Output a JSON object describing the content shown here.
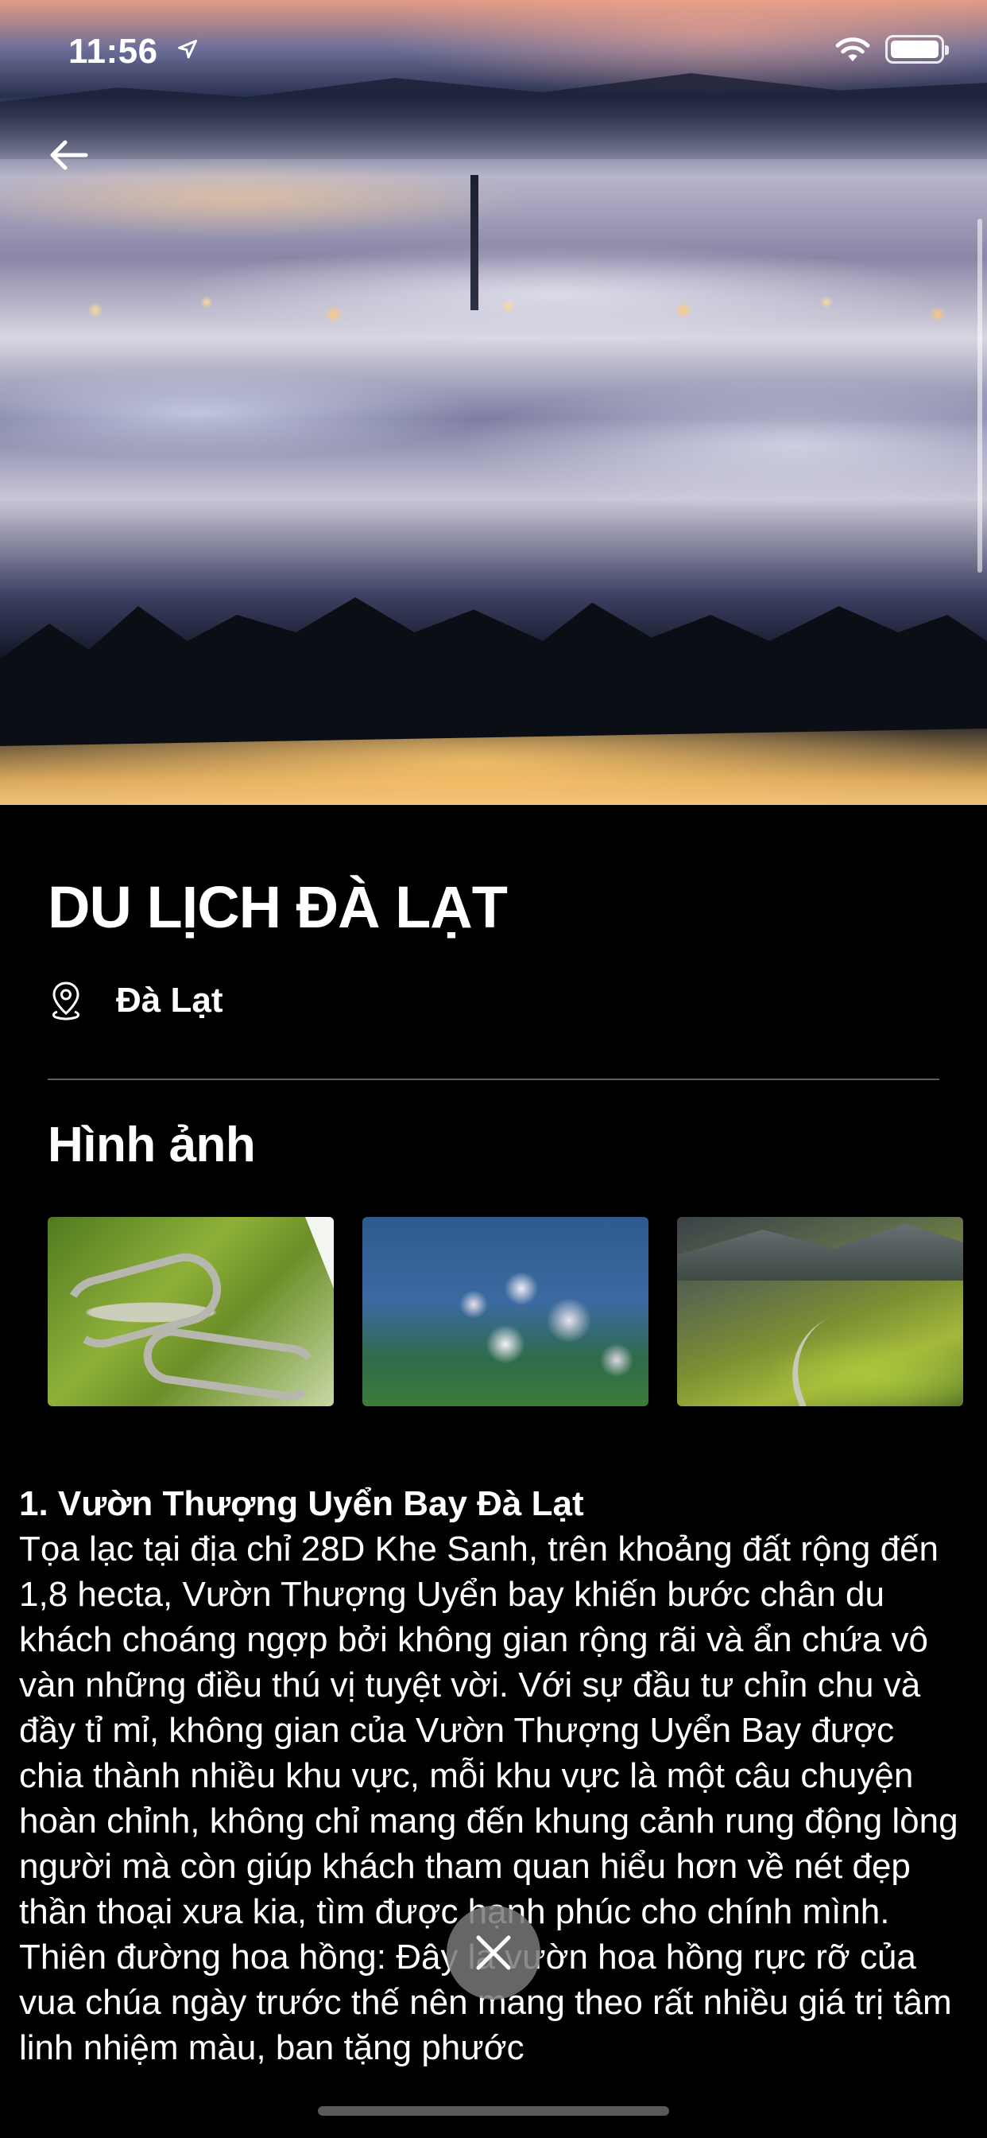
{
  "status_bar": {
    "time": "11:56"
  },
  "destination": {
    "title": "DU LỊCH ĐÀ LẠT",
    "location": "Đà Lạt"
  },
  "gallery": {
    "title": "Hình ảnh",
    "images": [
      "mountain-pass-road-photo",
      "blossom-tree-photo",
      "rice-terrace-valley-photo"
    ]
  },
  "article": {
    "heading": "1. Vườn Thượng Uyển Bay Đà Lạt",
    "paragraph_1": "Tọa lạc tại địa chỉ 28D Khe Sanh, trên khoảng đất rộng đến 1,8 hecta, Vườn Thượng Uyển bay khiến bước chân du khách choáng ngợp bởi không gian rộng rãi và ẩn chứa vô vàn những điều thú vị tuyệt vời. Với sự đầu tư chỉn chu và đầy tỉ mỉ, không gian của Vườn Thượng Uyển Bay được chia thành nhiều khu vực, mỗi khu vực là một câu chuyện hoàn chỉnh, không chỉ mang đến khung cảnh rung động lòng người mà còn giúp khách tham quan hiểu hơn về nét đẹp thần thoại xưa kia, tìm được hạnh phúc cho chính mình.",
    "paragraph_2": "Thiên đường hoa hồng: Đây là vườn hoa hồng rực rỡ của vua chúa ngày trước thế nên mang theo rất nhiều giá trị tâm linh nhiệm màu, ban tặng phước"
  },
  "icons": {
    "back": "arrow-left-icon",
    "location": "map-pin-icon",
    "close": "close-icon",
    "status_location": "location-arrow-icon",
    "wifi": "wifi-icon",
    "battery": "battery-icon"
  }
}
